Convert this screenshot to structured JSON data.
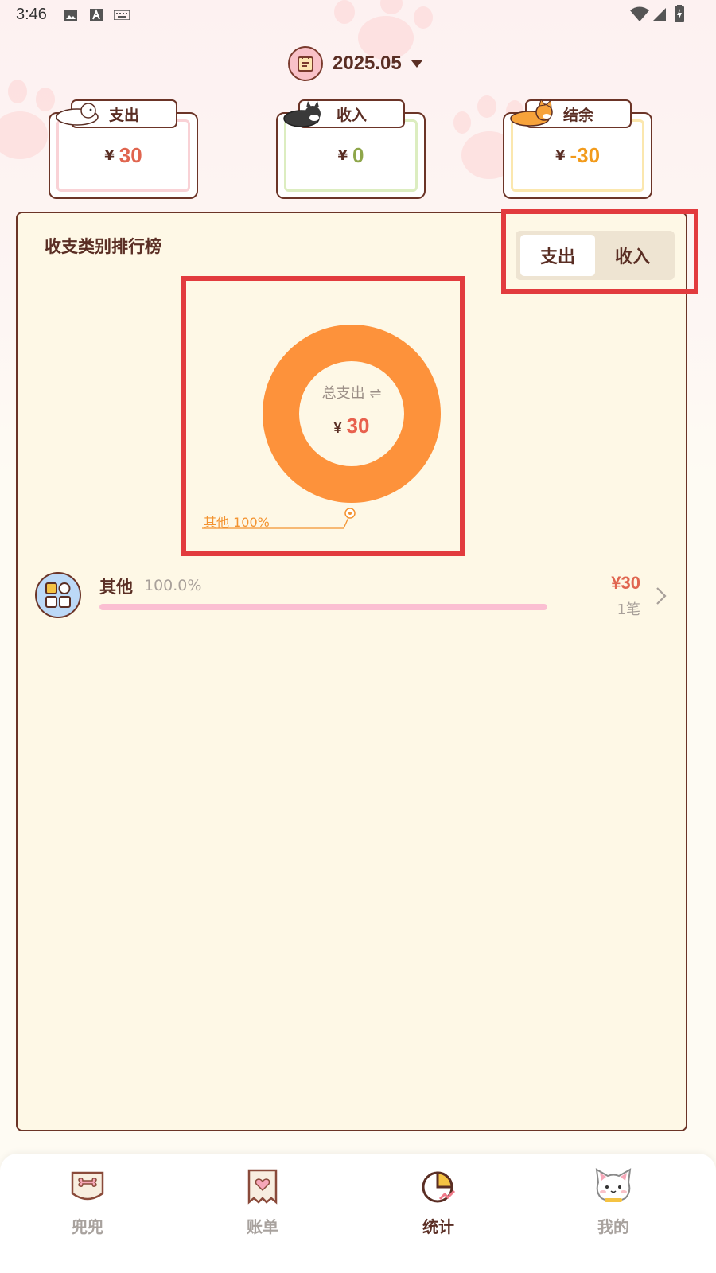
{
  "status_bar": {
    "time": "3:46"
  },
  "month_selector": {
    "label": "2025.05"
  },
  "summary": {
    "expense": {
      "label": "支出",
      "currency": "¥",
      "amount": "30",
      "color": "#e0654f"
    },
    "income": {
      "label": "收入",
      "currency": "¥",
      "amount": "0",
      "color": "#8ea64a"
    },
    "balance": {
      "label": "结余",
      "currency": "¥",
      "amount": "-30",
      "color": "#f29b1c"
    }
  },
  "ranking": {
    "title": "收支类别排行榜",
    "toggle": {
      "expense_label": "支出",
      "income_label": "收入",
      "selected": "支出"
    },
    "donut": {
      "center_label": "总支出 ⇌",
      "currency": "¥",
      "total": "30",
      "leader_label": "其他 100%",
      "color": "#fd923b"
    },
    "categories": [
      {
        "name": "其他",
        "percent": "100.0%",
        "amount": "¥30",
        "count": "1笔",
        "fraction": 1.0
      }
    ]
  },
  "chart_data": {
    "type": "pie",
    "categories": [
      "其他"
    ],
    "values": [
      30
    ],
    "labels": [
      "其他 100%"
    ]
  },
  "bottom_nav": {
    "items": [
      {
        "label": "兜兜",
        "icon": "bone-card-icon"
      },
      {
        "label": "账单",
        "icon": "bill-heart-icon"
      },
      {
        "label": "统计",
        "icon": "pie-chart-icon",
        "active": true
      },
      {
        "label": "我的",
        "icon": "cat-face-icon"
      }
    ]
  }
}
